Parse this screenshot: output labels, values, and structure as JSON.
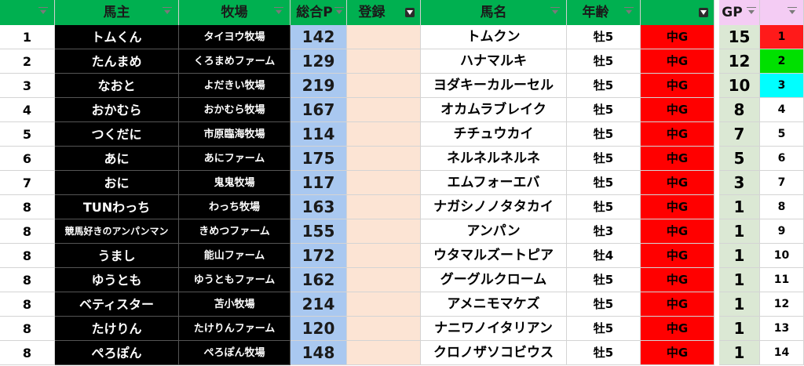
{
  "headers": {
    "owner": "馬主",
    "farm": "牧場",
    "points": "総合P",
    "registration": "登録",
    "horse": "馬名",
    "age": "年齢",
    "gp": "GP"
  },
  "colors": {
    "header_green": "#00b050",
    "owner_bg": "#000000",
    "points_bg": "#a9c8f0",
    "registration_bg": "#fce4d4",
    "grade_bg": "#ff0000",
    "gp_bg": "#dbe8d4",
    "gp_header_bg": "#f4ccf4",
    "rank1": "#ff1a1a",
    "rank2": "#00e000",
    "rank3": "#00ffff"
  },
  "rows": [
    {
      "rank": "1",
      "owner": "トムくん",
      "farm": "タイヨウ牧場",
      "points": "142",
      "horse": "トムクン",
      "age": "牡5",
      "grade": "中G",
      "gp": "15",
      "num": "1"
    },
    {
      "rank": "2",
      "owner": "たんまめ",
      "farm": "くろまめファーム",
      "points": "129",
      "horse": "ハナマルキ",
      "age": "牡5",
      "grade": "中G",
      "gp": "12",
      "num": "2"
    },
    {
      "rank": "3",
      "owner": "なおと",
      "farm": "よだきい牧場",
      "points": "219",
      "horse": "ヨダキーカルーセル",
      "age": "牡5",
      "grade": "中G",
      "gp": "10",
      "num": "3"
    },
    {
      "rank": "4",
      "owner": "おかむら",
      "farm": "おかむら牧場",
      "points": "167",
      "horse": "オカムラブレイク",
      "age": "牡5",
      "grade": "中G",
      "gp": "8",
      "num": "4"
    },
    {
      "rank": "5",
      "owner": "つくだに",
      "farm": "市原臨海牧場",
      "points": "114",
      "horse": "チチュウカイ",
      "age": "牡5",
      "grade": "中G",
      "gp": "7",
      "num": "5"
    },
    {
      "rank": "6",
      "owner": "あに",
      "farm": "あにファーム",
      "points": "175",
      "horse": "ネルネルネルネ",
      "age": "牡5",
      "grade": "中G",
      "gp": "5",
      "num": "6"
    },
    {
      "rank": "7",
      "owner": "おに",
      "farm": "鬼鬼牧場",
      "points": "117",
      "horse": "エムフォーエバ",
      "age": "牡5",
      "grade": "中G",
      "gp": "3",
      "num": "7"
    },
    {
      "rank": "8",
      "owner": "TUNわっち",
      "farm": "わっち牧場",
      "points": "163",
      "horse": "ナガシノノタタカイ",
      "age": "牡5",
      "grade": "中G",
      "gp": "1",
      "num": "8"
    },
    {
      "rank": "8",
      "owner": "競馬好きのアンパンマン",
      "farm": "きめつファーム",
      "points": "155",
      "horse": "アンパン",
      "age": "牡3",
      "grade": "中G",
      "gp": "1",
      "num": "9"
    },
    {
      "rank": "8",
      "owner": "うまし",
      "farm": "能山ファーム",
      "points": "172",
      "horse": "ウタマルズートピア",
      "age": "牡4",
      "grade": "中G",
      "gp": "1",
      "num": "10"
    },
    {
      "rank": "8",
      "owner": "ゆうとも",
      "farm": "ゆうともファーム",
      "points": "162",
      "horse": "グーグルクローム",
      "age": "牡5",
      "grade": "中G",
      "gp": "1",
      "num": "11"
    },
    {
      "rank": "8",
      "owner": "ベティスター",
      "farm": "苫小牧場",
      "points": "214",
      "horse": "アメニモマケズ",
      "age": "牡5",
      "grade": "中G",
      "gp": "1",
      "num": "12"
    },
    {
      "rank": "8",
      "owner": "たけりん",
      "farm": "たけりんファーム",
      "points": "120",
      "horse": "ナニワノイタリアン",
      "age": "牡5",
      "grade": "中G",
      "gp": "1",
      "num": "13"
    },
    {
      "rank": "8",
      "owner": "ぺろぽん",
      "farm": "ぺろぽん牧場",
      "points": "148",
      "horse": "クロノザソコビウス",
      "age": "牡5",
      "grade": "中G",
      "gp": "1",
      "num": "14"
    }
  ]
}
